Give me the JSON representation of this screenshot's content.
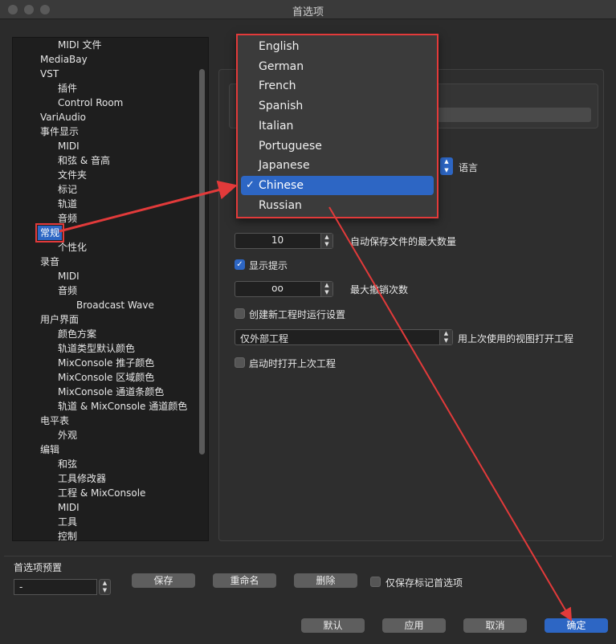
{
  "window": {
    "title": "首选项"
  },
  "sidebar": {
    "items": [
      {
        "label": "MIDI 文件",
        "level": 2
      },
      {
        "label": "MediaBay",
        "level": 1
      },
      {
        "label": "VST",
        "level": 1
      },
      {
        "label": "插件",
        "level": 2
      },
      {
        "label": "Control Room",
        "level": 2
      },
      {
        "label": "VariAudio",
        "level": 1
      },
      {
        "label": "事件显示",
        "level": 1
      },
      {
        "label": "MIDI",
        "level": 2
      },
      {
        "label": "和弦 & 音高",
        "level": 2
      },
      {
        "label": "文件夹",
        "level": 2
      },
      {
        "label": "标记",
        "level": 2
      },
      {
        "label": "轨道",
        "level": 2
      },
      {
        "label": "音频",
        "level": 2
      },
      {
        "label": "常规",
        "level": 1,
        "selected": true
      },
      {
        "label": "个性化",
        "level": 2
      },
      {
        "label": "录音",
        "level": 1
      },
      {
        "label": "MIDI",
        "level": 2
      },
      {
        "label": "音频",
        "level": 2
      },
      {
        "label": "Broadcast Wave",
        "level": 3
      },
      {
        "label": "用户界面",
        "level": 1
      },
      {
        "label": "颜色方案",
        "level": 2
      },
      {
        "label": "轨道类型默认颜色",
        "level": 2
      },
      {
        "label": "MixConsole 推子颜色",
        "level": 2
      },
      {
        "label": "MixConsole 区域颜色",
        "level": 2
      },
      {
        "label": "MixConsole 通道条颜色",
        "level": 2
      },
      {
        "label": "轨道 & MixConsole 通道颜色",
        "level": 2
      },
      {
        "label": "电平表",
        "level": 1
      },
      {
        "label": "外观",
        "level": 2
      },
      {
        "label": "编辑",
        "level": 1
      },
      {
        "label": "和弦",
        "level": 2
      },
      {
        "label": "工具修改器",
        "level": 2
      },
      {
        "label": "工程 & MixConsole",
        "level": 2
      },
      {
        "label": "MIDI",
        "level": 2
      },
      {
        "label": "工具",
        "level": 2
      },
      {
        "label": "控制",
        "level": 2
      }
    ]
  },
  "language_menu": {
    "options": [
      "English",
      "German",
      "French",
      "Spanish",
      "Italian",
      "Portuguese",
      "Japanese",
      "Chinese",
      "Russian"
    ],
    "selected": "Chinese",
    "check_glyph": "✓"
  },
  "settings": {
    "language_label": "语言",
    "autosave_value": "10",
    "autosave_label": "自动保存文件的最大数量",
    "show_tips_label": "显示提示",
    "show_tips_checked": true,
    "undo_value": "oo",
    "undo_label": "最大撤销次数",
    "run_setup_label": "创建新工程时运行设置",
    "run_setup_checked": false,
    "open_project_value": "仅外部工程",
    "open_project_label": "用上次使用的视图打开工程",
    "open_last_label": "启动时打开上次工程",
    "open_last_checked": false
  },
  "presets": {
    "title": "首选项预置",
    "field_value": "-",
    "save_label": "保存",
    "rename_label": "重命名",
    "delete_label": "删除",
    "only_marked_label": "仅保存标记首选项"
  },
  "footer": {
    "default_label": "默认",
    "apply_label": "应用",
    "cancel_label": "取消",
    "ok_label": "确定"
  },
  "colors": {
    "accent": "#2d66c4",
    "annotation": "#e23a3a"
  }
}
